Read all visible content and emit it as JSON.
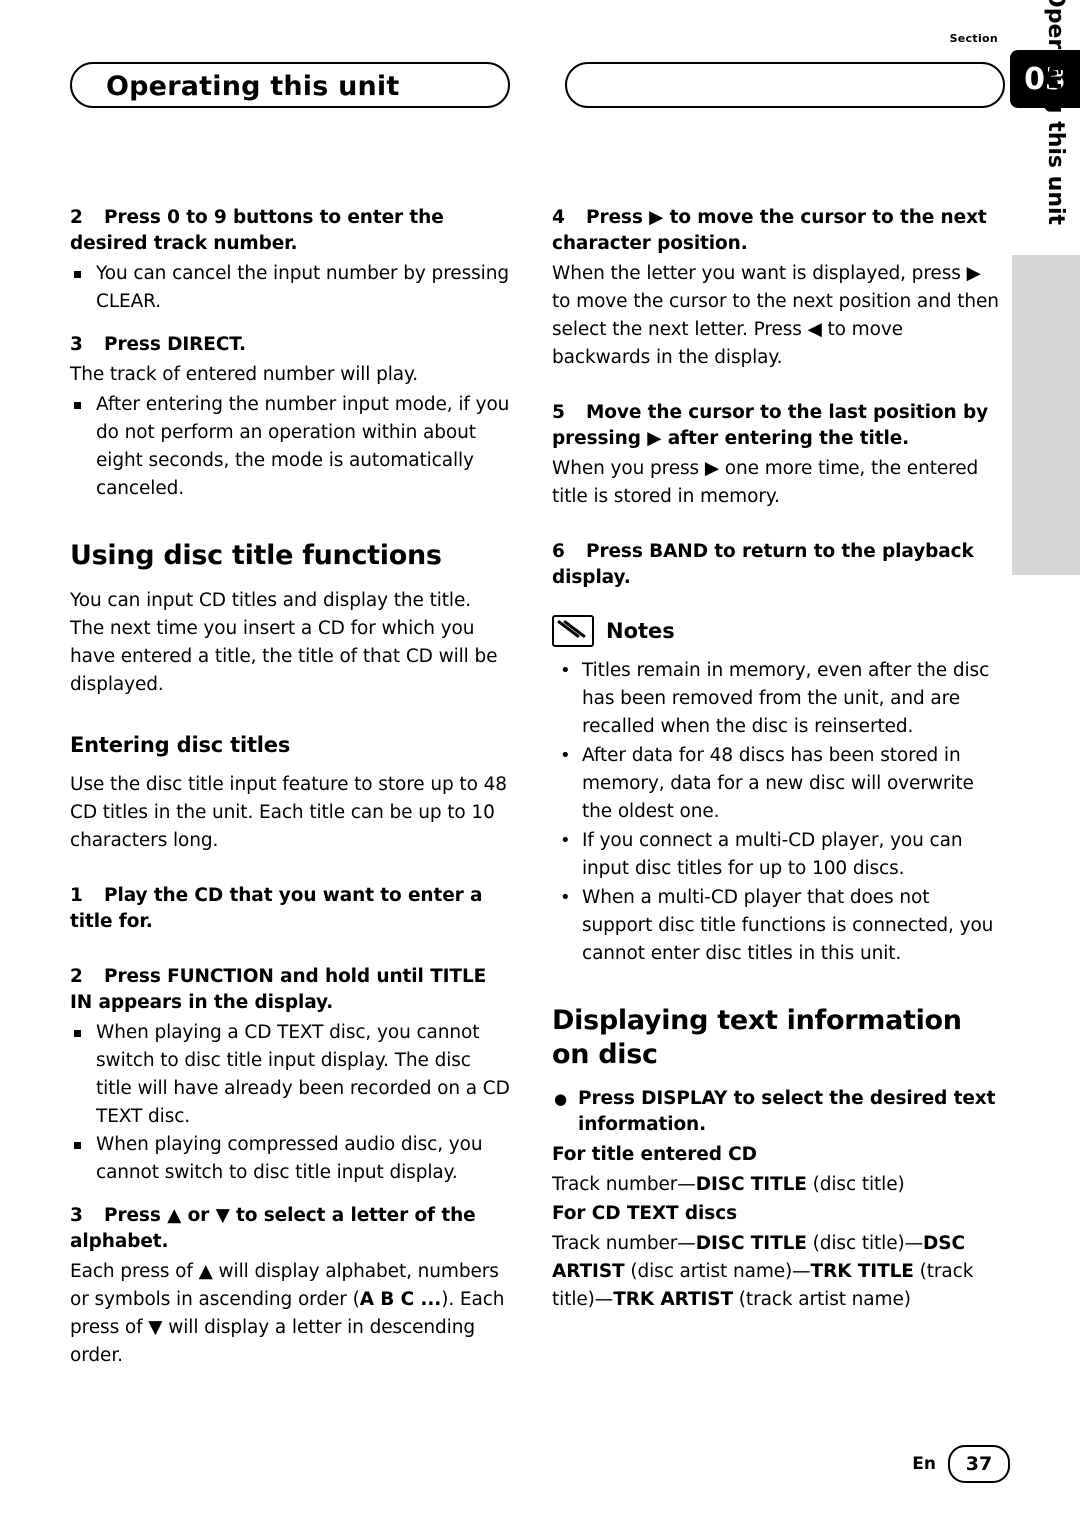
{
  "header": {
    "title": "Operating this unit",
    "section_label": "Section",
    "section_number": "03",
    "side_tab": "Operating this unit"
  },
  "left_column": {
    "step2_heading_num": "2",
    "step2_heading": "Press 0 to 9 buttons to enter the desired track number.",
    "step2_bullet": "You can cancel the input number by pressing CLEAR.",
    "step3_heading_num": "3",
    "step3_heading": "Press DIRECT.",
    "step3_body": "The track of entered number will play.",
    "step3_bullet": "After entering the number input mode, if you do not perform an operation within about eight seconds, the mode is automatically canceled.",
    "section_title": "Using disc title functions",
    "section_body": "You can input CD titles and display the title. The next time you insert a CD for which you have entered a title, the title of that CD will be displayed.",
    "sub_title": "Entering disc titles",
    "sub_body": "Use the disc title input feature to store up to 48 CD titles in the unit. Each title can be up to 10 characters long.",
    "e_step1_num": "1",
    "e_step1_heading": "Play the CD that you want to enter a title for.",
    "e_step2_num": "2",
    "e_step2_heading": "Press FUNCTION and hold until TITLE IN appears in the display.",
    "e_step2_bullet1": "When playing a CD TEXT disc, you cannot switch to disc title input display. The disc title will have already been recorded on a CD TEXT disc.",
    "e_step2_bullet2": "When playing compressed audio disc, you cannot switch to disc title input display.",
    "e_step3_num": "3",
    "e_step3_heading_a": "Press ",
    "e_step3_heading_up": "▲",
    "e_step3_heading_b": " or ",
    "e_step3_heading_down": "▼",
    "e_step3_heading_c": " to select a letter of the alphabet.",
    "e_step3_body_a": "Each press of ",
    "e_step3_body_up": "▲",
    "e_step3_body_b": " will display alphabet, numbers or symbols in ascending order (",
    "e_step3_body_abc": "A B C ...",
    "e_step3_body_c": "). Each press of ",
    "e_step3_body_down": "▼",
    "e_step3_body_d": " will display a letter in descending order."
  },
  "right_column": {
    "step4_num": "4",
    "step4_heading_a": "Press ",
    "step4_arrow": "▶",
    "step4_heading_b": " to move the cursor to the next character position.",
    "step4_body_a": "When the letter you want is displayed, press ",
    "step4_body_arrow1": "▶",
    "step4_body_b": " to move the cursor to the next position and then select the next letter. Press ",
    "step4_body_arrow2": "◀",
    "step4_body_c": " to move backwards in the display.",
    "step5_num": "5",
    "step5_heading_a": "Move the cursor to the last position by pressing ",
    "step5_arrow": "▶",
    "step5_heading_b": " after entering the title.",
    "step5_body_a": "When you press ",
    "step5_body_arrow": "▶",
    "step5_body_b": " one more time, the entered title is stored in memory.",
    "step6_num": "6",
    "step6_heading": "Press BAND to return to the playback display.",
    "notes_title": "Notes",
    "note1": "Titles remain in memory, even after the disc has been removed from the unit, and are recalled when the disc is reinserted.",
    "note2": "After data for 48 discs has been stored in memory, data for a new disc will overwrite the oldest one.",
    "note3": "If you connect a multi-CD player, you can input disc titles for up to 100 discs.",
    "note4": "When a multi-CD player that does not support disc title functions is connected, you cannot enter disc titles in this unit.",
    "section_title": "Displaying text information on disc",
    "display_bullet": "Press DISPLAY to select the desired text information.",
    "sub1": "For title entered CD",
    "sub1_line_a": "Track number—",
    "sub1_line_b": "DISC TITLE",
    "sub1_line_c": " (disc title)",
    "sub2": "For CD TEXT discs",
    "sub2_line1_a": "Track number—",
    "sub2_line1_b": "DISC TITLE",
    "sub2_line1_c": " (disc title)—",
    "sub2_line2_a": "DSC ARTIST",
    "sub2_line2_b": " (disc artist name)—",
    "sub2_line2_c": "TRK TITLE",
    "sub2_line3_a": " (track title)—",
    "sub2_line3_b": "TRK ARTIST",
    "sub2_line3_c": " (track artist name)"
  },
  "footer": {
    "lang": "En",
    "page": "37"
  }
}
